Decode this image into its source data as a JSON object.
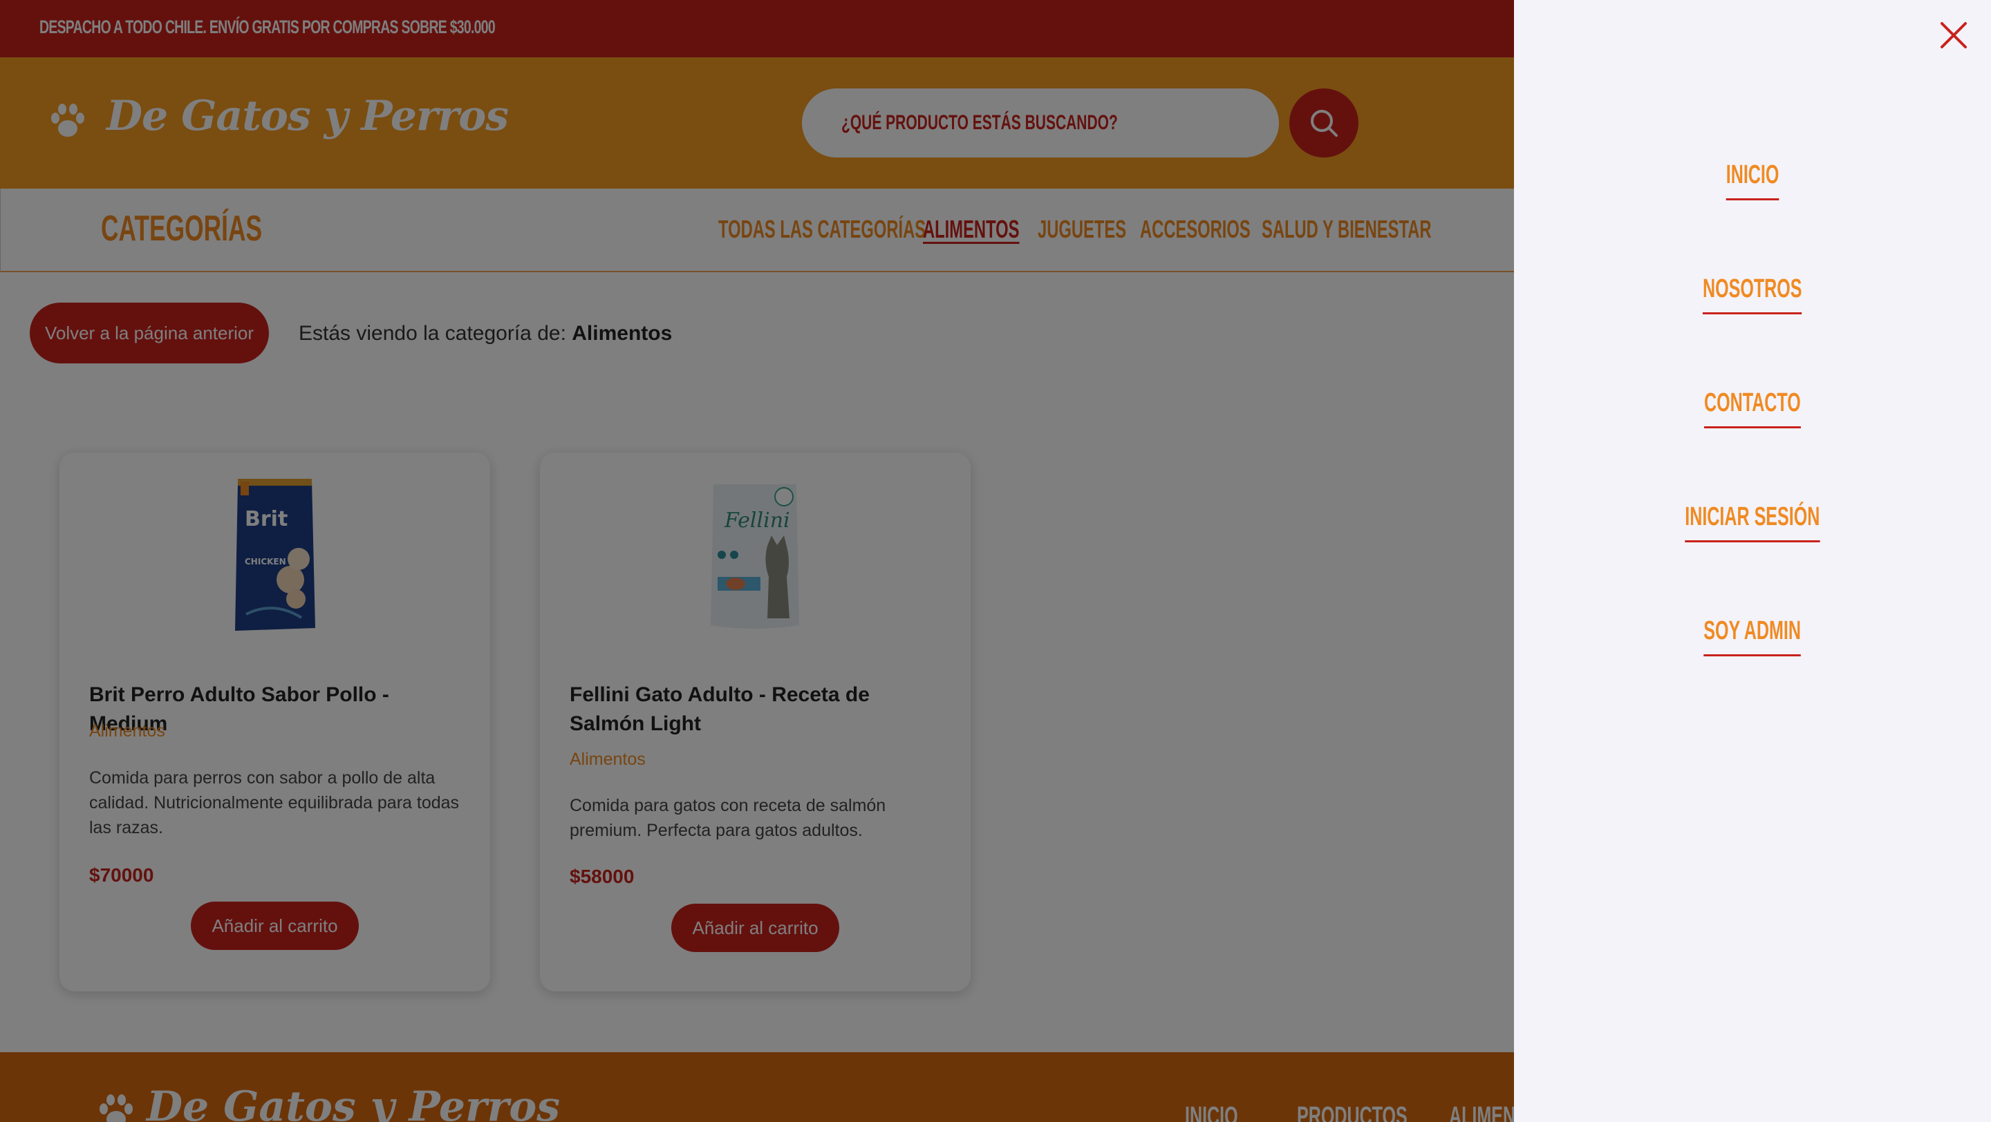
{
  "topbar": {
    "text": "Despacho a todo Chile. Envío gratis por compras sobre $30.000"
  },
  "header": {
    "logo_text": "De Gatos y Perros",
    "search_placeholder": "¿Qué producto estás buscando?"
  },
  "categories": {
    "title": "Categorías",
    "links": [
      {
        "label": "Todas las categorías",
        "active": false
      },
      {
        "label": "Alimentos",
        "active": true
      },
      {
        "label": "Juguetes",
        "active": false
      },
      {
        "label": "Accesorios",
        "active": false
      },
      {
        "label": "Salud y bienestar",
        "active": false
      }
    ]
  },
  "main": {
    "back_button": "Volver a la página anterior",
    "viewing_prefix": "Estás viendo la categoría de:",
    "viewing_category": "Alimentos"
  },
  "products": [
    {
      "name": "Brit Perro Adulto Sabor Pollo - Medium",
      "category": "Alimentos",
      "description": "Comida para perros con sabor a pollo de alta calidad. Nutricionalmente equilibrada para todas las razas.",
      "price": "$70000",
      "button": "Añadir al carrito",
      "image_brand": "Brit",
      "image_flavor": "CHICKEN"
    },
    {
      "name": "Fellini Gato Adulto - Receta de Salmón Light",
      "category": "Alimentos",
      "description": "Comida para gatos con receta de salmón premium. Perfecta para gatos adultos.",
      "price": "$58000",
      "button": "Añadir al carrito",
      "image_brand": "Fellini"
    }
  ],
  "footer": {
    "logo_text": "De Gatos y Perros",
    "links": [
      "Inicio",
      "Productos",
      "Alimentos"
    ]
  },
  "side_menu": {
    "items": [
      "Inicio",
      "Nosotros",
      "Contacto",
      "Iniciar sesión",
      "Soy admin"
    ]
  },
  "colors": {
    "primary_red": "#c8221c",
    "orange": "#f49a22",
    "accent_orange": "#f08a22",
    "menu_bg": "#f4f3f9"
  }
}
